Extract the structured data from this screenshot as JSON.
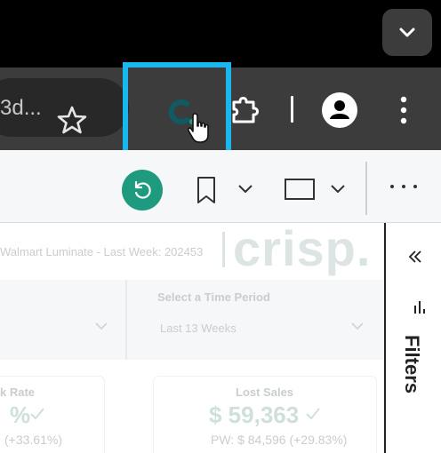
{
  "browser": {
    "omnibox": {
      "text": "3d..."
    },
    "icons": {
      "tab_menu": "chevron-down-icon",
      "bookmark_star": "star-outline-icon",
      "extension_crisp": "crisp-c-logo-icon",
      "cursor": "hand-pointer-icon",
      "extensions": "puzzle-piece-icon",
      "profile": "person-avatar-icon",
      "menu": "vertical-dots-icon"
    },
    "highlight_color": "#1ab7ee"
  },
  "report_toolbar": {
    "icons": {
      "reset": "reset-arrow-icon",
      "bookmark": "bookmark-icon",
      "view": "window-view-icon",
      "more": "horizontal-dots-icon"
    },
    "reset_color": "#1e9a7f"
  },
  "report": {
    "source_text": "Walmart Luminate - Last Week: 202453",
    "logo_text": "crisp",
    "logo_dot": ".",
    "slicer": {
      "title": "Select a Time Period",
      "value": "Last 13 Weeks"
    },
    "kpis": [
      {
        "title": "k Rate",
        "value": "%",
        "sub": "(+33.61%)"
      },
      {
        "title": "Lost Sales",
        "value": "$ 59,363",
        "sub": "PW: $ 84,596 (+29.83%)"
      }
    ]
  },
  "filters_pane": {
    "label": "Filters",
    "icons": {
      "collapse": "double-chevron-left-icon",
      "filter": "filter-bars-icon"
    }
  }
}
